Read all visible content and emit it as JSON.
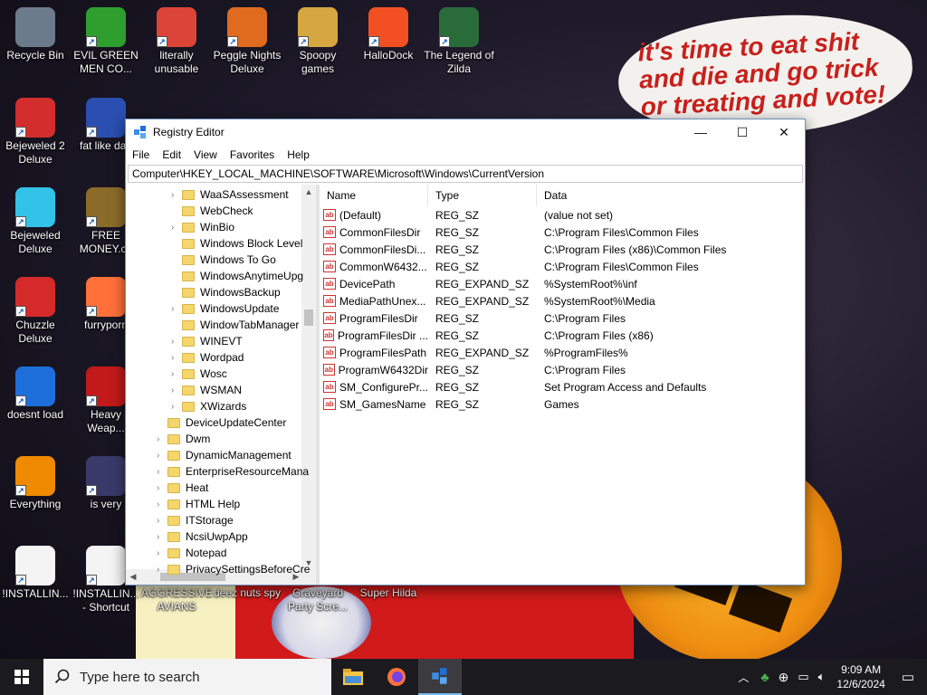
{
  "speech_bubble": "it's time to eat shit and die and go trick or treating and vote!",
  "desktop_icons": [
    {
      "label": "Recycle Bin",
      "icon": "recycle-bin-icon",
      "color": "#6b7b8c"
    },
    {
      "label": "EVIL GREEN MEN CO...",
      "icon": "green-men-icon",
      "color": "#2e9e2e"
    },
    {
      "label": "literally unusable",
      "icon": "chrome-icon",
      "color": "#db4437"
    },
    {
      "label": "Peggle Nights Deluxe",
      "icon": "peggle-icon",
      "color": "#e06a1e"
    },
    {
      "label": "Spoopy games",
      "icon": "folder-games-icon",
      "color": "#d6a640"
    },
    {
      "label": "HalloDock",
      "icon": "windows-logo-icon",
      "color": "#f25022"
    },
    {
      "label": "The Legend of Zilda",
      "icon": "zilda-icon",
      "color": "#2a6b3a"
    },
    {
      "label": "Bejeweled 2 Deluxe",
      "icon": "bejeweled2-icon",
      "color": "#d32d2d"
    },
    {
      "label": "fat like darl",
      "icon": "mpl-icon",
      "color": "#2a4fb0"
    },
    {
      "label": "Bejeweled Deluxe",
      "icon": "diamond-icon",
      "color": "#33c3e8"
    },
    {
      "label": "FREE MONEY.co",
      "icon": "money-bag-icon",
      "color": "#8b6b2a"
    },
    {
      "label": "Chuzzle Deluxe",
      "icon": "chuzzle-icon",
      "color": "#d42a2a"
    },
    {
      "label": "furryporn",
      "icon": "firefox-icon",
      "color": "#ff7139"
    },
    {
      "label": "doesnt load",
      "icon": "thunderbird-icon",
      "color": "#1e6fd9"
    },
    {
      "label": "Heavy Weap...",
      "icon": "radiation-icon",
      "color": "#c21a1a"
    },
    {
      "label": "Everything",
      "icon": "search-magnifier-icon",
      "color": "#f08a00"
    },
    {
      "label": "is very",
      "icon": "shield-logo-icon",
      "color": "#3a3a6a"
    },
    {
      "label": "!INSTALLIN...",
      "icon": "text-file-icon",
      "color": "#f4f4f4"
    },
    {
      "label": "!INSTALLIN... - Shortcut",
      "icon": "text-file-shortcut-icon",
      "color": "#f4f4f4"
    },
    {
      "label": "AGGRESSIVE AVIANS",
      "icon": "",
      "color": ""
    },
    {
      "label": "deez nuts spy",
      "icon": "",
      "color": ""
    },
    {
      "label": "Graveyard Party Scre...",
      "icon": "",
      "color": ""
    },
    {
      "label": "Super Hilda",
      "icon": "",
      "color": ""
    }
  ],
  "window": {
    "title": "Registry Editor",
    "controls": {
      "minimize": "—",
      "maximize": "☐",
      "close": "✕"
    },
    "menu": [
      "File",
      "Edit",
      "View",
      "Favorites",
      "Help"
    ],
    "address": "Computer\\HKEY_LOCAL_MACHINE\\SOFTWARE\\Microsoft\\Windows\\CurrentVersion",
    "tree": [
      {
        "label": "WaaSAssessment",
        "level": 2,
        "expandable": true
      },
      {
        "label": "WebCheck",
        "level": 2,
        "expandable": false
      },
      {
        "label": "WinBio",
        "level": 2,
        "expandable": true
      },
      {
        "label": "Windows Block Level",
        "level": 2,
        "expandable": false
      },
      {
        "label": "Windows To Go",
        "level": 2,
        "expandable": false
      },
      {
        "label": "WindowsAnytimeUpg",
        "level": 2,
        "expandable": false
      },
      {
        "label": "WindowsBackup",
        "level": 2,
        "expandable": false
      },
      {
        "label": "WindowsUpdate",
        "level": 2,
        "expandable": true
      },
      {
        "label": "WindowTabManager",
        "level": 2,
        "expandable": false
      },
      {
        "label": "WINEVT",
        "level": 2,
        "expandable": true
      },
      {
        "label": "Wordpad",
        "level": 2,
        "expandable": true
      },
      {
        "label": "Wosc",
        "level": 2,
        "expandable": true
      },
      {
        "label": "WSMAN",
        "level": 2,
        "expandable": true
      },
      {
        "label": "XWizards",
        "level": 2,
        "expandable": true
      },
      {
        "label": "DeviceUpdateCenter",
        "level": 1,
        "expandable": false
      },
      {
        "label": "Dwm",
        "level": 1,
        "expandable": true
      },
      {
        "label": "DynamicManagement",
        "level": 1,
        "expandable": true
      },
      {
        "label": "EnterpriseResourceMana",
        "level": 1,
        "expandable": true
      },
      {
        "label": "Heat",
        "level": 1,
        "expandable": true
      },
      {
        "label": "HTML Help",
        "level": 1,
        "expandable": true
      },
      {
        "label": "ITStorage",
        "level": 1,
        "expandable": true
      },
      {
        "label": "NcsiUwpApp",
        "level": 1,
        "expandable": true
      },
      {
        "label": "Notepad",
        "level": 1,
        "expandable": true
      },
      {
        "label": "PrivacySettingsBeforeCre",
        "level": 1,
        "expandable": true
      }
    ],
    "columns": {
      "name": "Name",
      "type": "Type",
      "data": "Data"
    },
    "values": [
      {
        "name": "(Default)",
        "type": "REG_SZ",
        "data": "(value not set)"
      },
      {
        "name": "CommonFilesDir",
        "type": "REG_SZ",
        "data": "C:\\Program Files\\Common Files"
      },
      {
        "name": "CommonFilesDi...",
        "type": "REG_SZ",
        "data": "C:\\Program Files (x86)\\Common Files"
      },
      {
        "name": "CommonW6432...",
        "type": "REG_SZ",
        "data": "C:\\Program Files\\Common Files"
      },
      {
        "name": "DevicePath",
        "type": "REG_EXPAND_SZ",
        "data": "%SystemRoot%\\inf"
      },
      {
        "name": "MediaPathUnex...",
        "type": "REG_EXPAND_SZ",
        "data": "%SystemRoot%\\Media"
      },
      {
        "name": "ProgramFilesDir",
        "type": "REG_SZ",
        "data": "C:\\Program Files"
      },
      {
        "name": "ProgramFilesDir ...",
        "type": "REG_SZ",
        "data": "C:\\Program Files (x86)"
      },
      {
        "name": "ProgramFilesPath",
        "type": "REG_EXPAND_SZ",
        "data": "%ProgramFiles%"
      },
      {
        "name": "ProgramW6432Dir",
        "type": "REG_SZ",
        "data": "C:\\Program Files"
      },
      {
        "name": "SM_ConfigurePr...",
        "type": "REG_SZ",
        "data": "Set Program Access and Defaults"
      },
      {
        "name": "SM_GamesName",
        "type": "REG_SZ",
        "data": "Games"
      }
    ],
    "value_icon_text": "ab"
  },
  "taskbar": {
    "search_placeholder": "Type here to search",
    "pinned": [
      {
        "name": "file-explorer-icon",
        "active": false
      },
      {
        "name": "firefox-icon",
        "active": false
      },
      {
        "name": "registry-editor-icon",
        "active": true
      }
    ],
    "time": "9:09 AM",
    "date": "12/6/2024"
  }
}
